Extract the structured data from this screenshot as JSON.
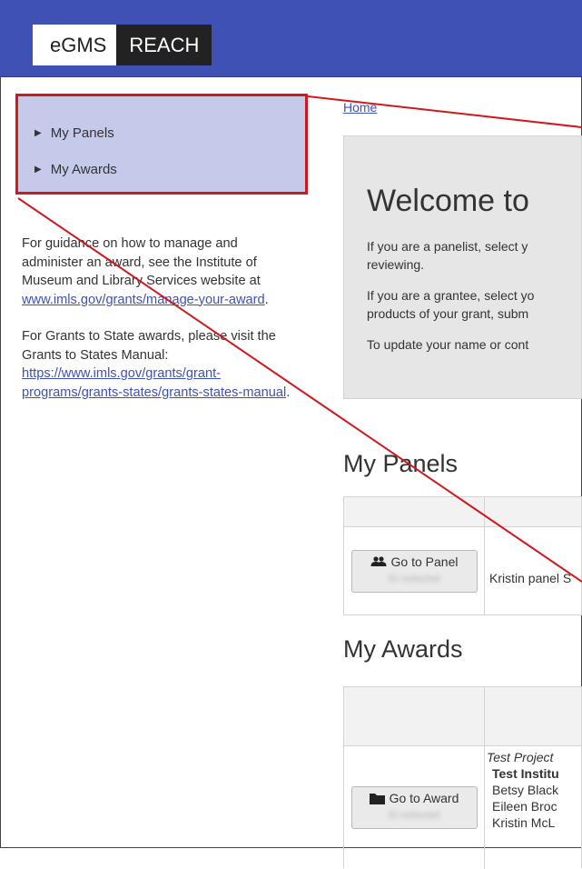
{
  "header": {
    "logo_primary": "eGMS",
    "logo_secondary": "REACH"
  },
  "sidebar": {
    "nav_items": [
      {
        "label": "My Panels"
      },
      {
        "label": "My Awards"
      }
    ],
    "guidance": {
      "text": "For guidance on how to manage and administer an award, see the Institute of Museum and Library Services website at ",
      "link": "www.imls.gov/grants/manage-your-award",
      "suffix": "."
    },
    "states": {
      "text": "For Grants to State awards, please visit the Grants to States Manual: ",
      "link": "https://www.imls.gov/grants/grant-programs/grants-states/grants-states-manual",
      "suffix": "."
    }
  },
  "main": {
    "breadcrumb": "Home",
    "welcome": {
      "title": "Welcome to",
      "p1": "If you are a panelist, select y",
      "p1b": "reviewing.",
      "p2": "If you are a grantee, select yo",
      "p2b": "products of your grant, subm",
      "p3": "To update your name or cont"
    },
    "panels": {
      "title": "My Panels",
      "button_label": "Go to Panel",
      "button_sub": "ID redacted",
      "row_text": "Kristin panel S"
    },
    "awards": {
      "title": "My Awards",
      "button_label": "Go to Award",
      "button_sub": "ID redacted",
      "project": "Test Project",
      "institution": "Test Institu",
      "people": [
        "Betsy Black",
        "Eileen Broc",
        "Kristin McL"
      ]
    }
  },
  "colors": {
    "header": "#3f51b5",
    "highlight_box": "#d0181f",
    "sidebar_bg": "#c5c9ea"
  }
}
